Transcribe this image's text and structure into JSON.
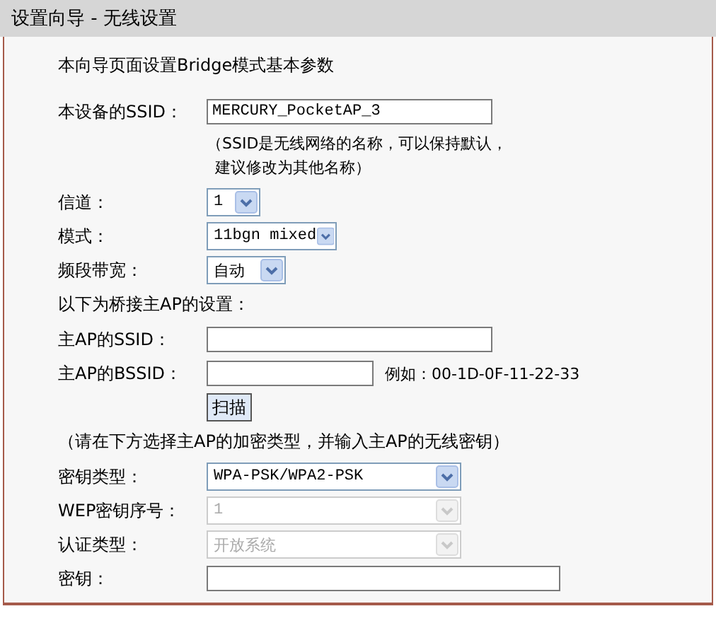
{
  "window": {
    "title": "设置向导 - 无线设置"
  },
  "intro": "本向导页面设置Bridge模式基本参数",
  "rows": [
    {
      "kind": "input",
      "label": "本设备的SSID：",
      "value": "MERCURY_PocketAP_3"
    },
    {
      "kind": "note",
      "lines": [
        "（SSID是无线网络的名称，可以保持默认，",
        "建议修改为其他名称）"
      ]
    },
    {
      "kind": "select",
      "label": "信道：",
      "value": "1",
      "disabled": false
    },
    {
      "kind": "select",
      "label": "模式：",
      "value": "11bgn mixed",
      "disabled": false
    },
    {
      "kind": "select",
      "label": "频段带宽：",
      "value": "自动",
      "disabled": false
    },
    {
      "kind": "heading",
      "text": "以下为桥接主AP的设置："
    },
    {
      "kind": "input",
      "label": "主AP的SSID：",
      "value": ""
    },
    {
      "kind": "input",
      "label": "主AP的BSSID：",
      "value": "",
      "hint": "例如：00-1D-0F-11-22-33"
    },
    {
      "kind": "button",
      "text": "扫描"
    },
    {
      "kind": "heading",
      "text": "（请在下方选择主AP的加密类型，并输入主AP的无线密钥）"
    },
    {
      "kind": "select",
      "label": "密钥类型：",
      "value": "WPA-PSK/WPA2-PSK",
      "disabled": false
    },
    {
      "kind": "select",
      "label": "WEP密钥序号：",
      "value": "1",
      "disabled": true
    },
    {
      "kind": "select",
      "label": "认证类型：",
      "value": "开放系统",
      "disabled": true
    },
    {
      "kind": "input",
      "label": "密钥：",
      "value": ""
    }
  ]
}
